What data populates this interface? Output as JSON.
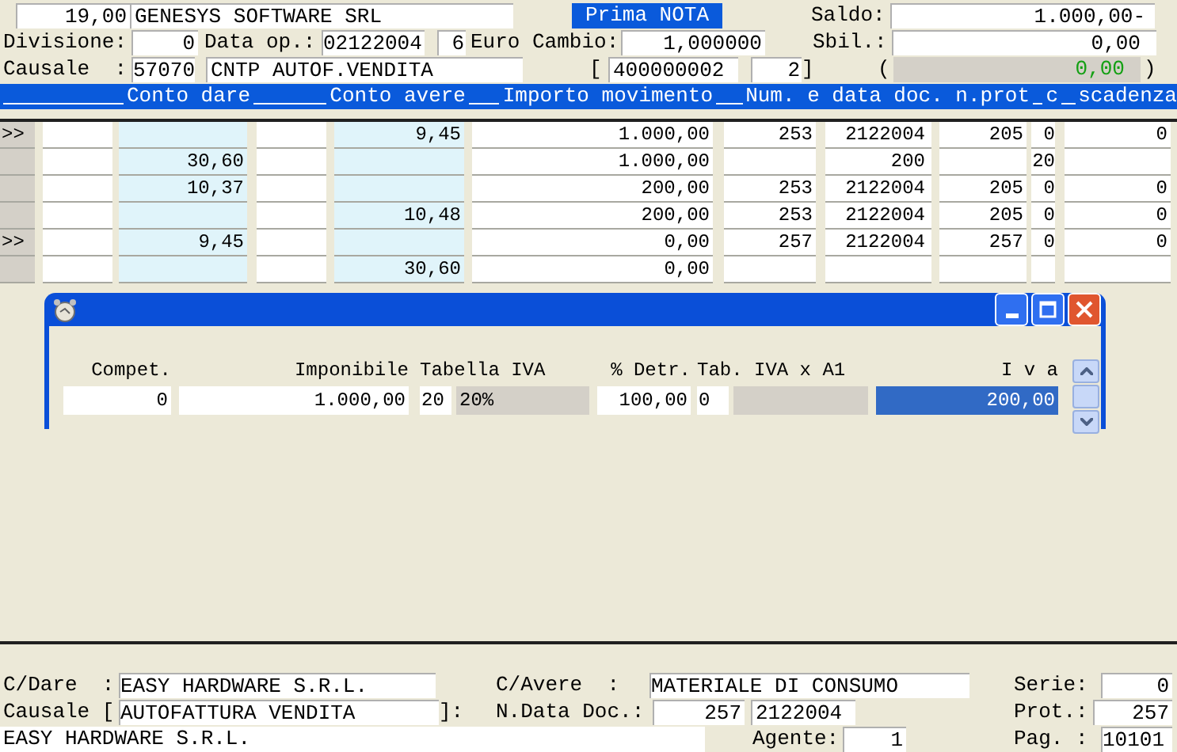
{
  "header": {
    "amount": "19,00",
    "company": "GENESYS SOFTWARE SRL",
    "title": "Prima NOTA",
    "saldo_label": "Saldo:",
    "saldo": "1.000,00-"
  },
  "line2": {
    "divisione_label": "Divisione:",
    "divisione": "0",
    "data_op_label": "Data op.:",
    "data_op": "02122004",
    "currency_code": "6",
    "cambio_label": "Euro Cambio:",
    "cambio": "1,000000",
    "sbil_label": "Sbil.:",
    "sbil": "0,00"
  },
  "line3": {
    "causale_label": "Causale  :",
    "causale_code": "57070",
    "causale_desc": "CNTP AUTOF.VENDITA",
    "bracket_open": "[",
    "reference": "400000002",
    "reference_no": "2",
    "bracket_close": "]",
    "paren_open": "(",
    "difference": "0,00",
    "paren_close": ")"
  },
  "grid": {
    "columns": [
      "Conto dare",
      "Conto avere",
      "Importo movimento",
      "Num. e data doc. n.prot",
      "c",
      "scadenza"
    ],
    "rows": [
      {
        "marker": ">>",
        "dare": "",
        "avere": "9,45",
        "importo": "1.000,00",
        "num": "253",
        "date": "2122004",
        "prot": "205",
        "c": "0",
        "scadenza": "0"
      },
      {
        "marker": "",
        "dare": "30,60",
        "avere": "",
        "importo": "1.000,00",
        "num": "",
        "date": "200",
        "prot": "",
        "c": "20",
        "scadenza": ""
      },
      {
        "marker": "",
        "dare": "10,37",
        "avere": "",
        "importo": "200,00",
        "num": "253",
        "date": "2122004",
        "prot": "205",
        "c": "0",
        "scadenza": "0"
      },
      {
        "marker": "",
        "dare": "",
        "avere": "10,48",
        "importo": "200,00",
        "num": "253",
        "date": "2122004",
        "prot": "205",
        "c": "0",
        "scadenza": "0"
      },
      {
        "marker": ">>",
        "dare": "9,45",
        "avere": "",
        "importo": "0,00",
        "num": "257",
        "date": "2122004",
        "prot": "257",
        "c": "0",
        "scadenza": "0"
      },
      {
        "marker": "",
        "dare": "",
        "avere": "30,60",
        "importo": "0,00",
        "num": "",
        "date": "",
        "prot": "",
        "c": "",
        "scadenza": ""
      }
    ]
  },
  "dialog": {
    "columns": [
      {
        "kind": "single",
        "label": "Compet.",
        "value": "0",
        "highlighted": false
      },
      {
        "kind": "single",
        "label": "Imponibile",
        "value": "1.000,00",
        "highlighted": false
      },
      {
        "kind": "coded",
        "label": "Tabella IVA",
        "code": "20",
        "description": "20%",
        "highlighted": false
      },
      {
        "kind": "single",
        "label": "% Detr.",
        "value": "100,00",
        "highlighted": false
      },
      {
        "kind": "coded",
        "label": "Tab. IVA x A1",
        "code": "0",
        "highlighted": false
      },
      {
        "kind": "single",
        "label": "I v a",
        "value": "200,00",
        "highlighted": true
      }
    ]
  },
  "footer": {
    "dare_label": "C/Dare  :",
    "dare": "EASY HARDWARE S.R.L.",
    "avere_label": "C/Avere  :",
    "avere": "MATERIALE DI CONSUMO",
    "serie_label": "Serie:",
    "serie": "0",
    "causale_label": "Causale [",
    "causale": "AUTOFATTURA VENDITA",
    "causale_close": "]:",
    "ndata_label": "N.Data Doc.:",
    "doc_number": "257",
    "doc_date": "2122004",
    "prot_label": "Prot.:",
    "prot": "257",
    "customer": "EASY HARDWARE S.R.L.",
    "agente_label": "Agente:",
    "agente": "1",
    "pag_label": "Pag. :",
    "pag": "10101"
  }
}
